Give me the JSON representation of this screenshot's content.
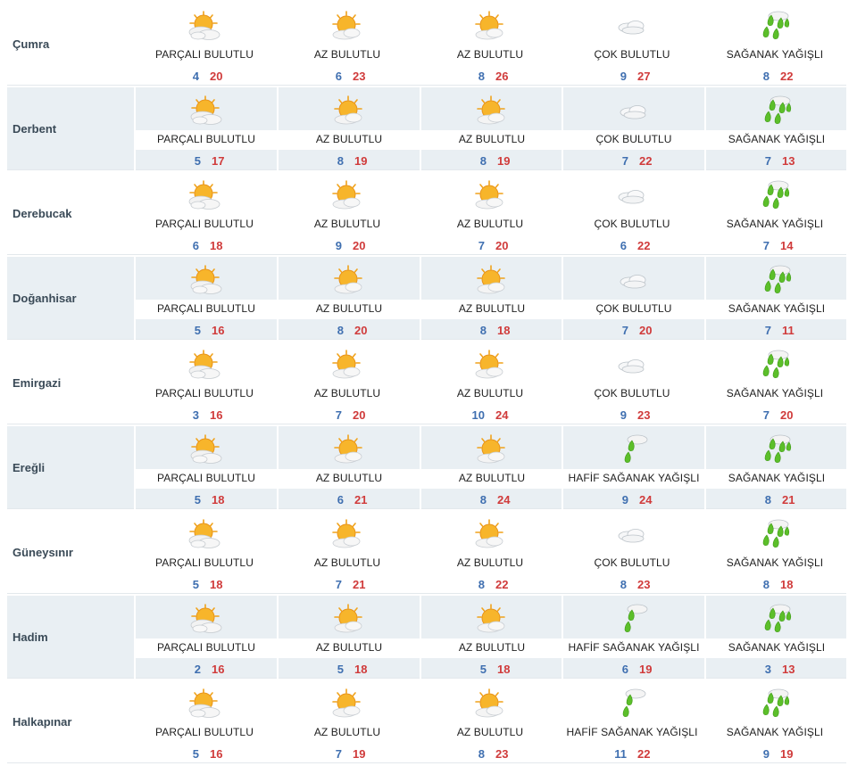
{
  "forecast": {
    "rows": [
      {
        "city": "Çumra",
        "days": [
          {
            "icon": "partly-cloudy-icon",
            "desc": "PARÇALI BULUTLU",
            "min": "4",
            "max": "20"
          },
          {
            "icon": "mostly-sunny-icon",
            "desc": "AZ BULUTLU",
            "min": "6",
            "max": "23"
          },
          {
            "icon": "mostly-sunny-icon",
            "desc": "AZ BULUTLU",
            "min": "8",
            "max": "26"
          },
          {
            "icon": "cloudy-icon",
            "desc": "ÇOK BULUTLU",
            "min": "9",
            "max": "27"
          },
          {
            "icon": "showers-icon",
            "desc": "SAĞANAK YAĞIŞLI",
            "min": "8",
            "max": "22"
          }
        ]
      },
      {
        "city": "Derbent",
        "days": [
          {
            "icon": "partly-cloudy-icon",
            "desc": "PARÇALI BULUTLU",
            "min": "5",
            "max": "17"
          },
          {
            "icon": "mostly-sunny-icon",
            "desc": "AZ BULUTLU",
            "min": "8",
            "max": "19"
          },
          {
            "icon": "mostly-sunny-icon",
            "desc": "AZ BULUTLU",
            "min": "8",
            "max": "19"
          },
          {
            "icon": "cloudy-icon",
            "desc": "ÇOK BULUTLU",
            "min": "7",
            "max": "22"
          },
          {
            "icon": "showers-icon",
            "desc": "SAĞANAK YAĞIŞLI",
            "min": "7",
            "max": "13"
          }
        ]
      },
      {
        "city": "Derebucak",
        "days": [
          {
            "icon": "partly-cloudy-icon",
            "desc": "PARÇALI BULUTLU",
            "min": "6",
            "max": "18"
          },
          {
            "icon": "mostly-sunny-icon",
            "desc": "AZ BULUTLU",
            "min": "9",
            "max": "20"
          },
          {
            "icon": "mostly-sunny-icon",
            "desc": "AZ BULUTLU",
            "min": "7",
            "max": "20"
          },
          {
            "icon": "cloudy-icon",
            "desc": "ÇOK BULUTLU",
            "min": "6",
            "max": "22"
          },
          {
            "icon": "showers-icon",
            "desc": "SAĞANAK YAĞIŞLI",
            "min": "7",
            "max": "14"
          }
        ]
      },
      {
        "city": "Doğanhisar",
        "days": [
          {
            "icon": "partly-cloudy-icon",
            "desc": "PARÇALI BULUTLU",
            "min": "5",
            "max": "16"
          },
          {
            "icon": "mostly-sunny-icon",
            "desc": "AZ BULUTLU",
            "min": "8",
            "max": "20"
          },
          {
            "icon": "mostly-sunny-icon",
            "desc": "AZ BULUTLU",
            "min": "8",
            "max": "18"
          },
          {
            "icon": "cloudy-icon",
            "desc": "ÇOK BULUTLU",
            "min": "7",
            "max": "20"
          },
          {
            "icon": "showers-icon",
            "desc": "SAĞANAK YAĞIŞLI",
            "min": "7",
            "max": "11"
          }
        ]
      },
      {
        "city": "Emirgazi",
        "days": [
          {
            "icon": "partly-cloudy-icon",
            "desc": "PARÇALI BULUTLU",
            "min": "3",
            "max": "16"
          },
          {
            "icon": "mostly-sunny-icon",
            "desc": "AZ BULUTLU",
            "min": "7",
            "max": "20"
          },
          {
            "icon": "mostly-sunny-icon",
            "desc": "AZ BULUTLU",
            "min": "10",
            "max": "24"
          },
          {
            "icon": "cloudy-icon",
            "desc": "ÇOK BULUTLU",
            "min": "9",
            "max": "23"
          },
          {
            "icon": "showers-icon",
            "desc": "SAĞANAK YAĞIŞLI",
            "min": "7",
            "max": "20"
          }
        ]
      },
      {
        "city": "Ereğli",
        "days": [
          {
            "icon": "partly-cloudy-icon",
            "desc": "PARÇALI BULUTLU",
            "min": "5",
            "max": "18"
          },
          {
            "icon": "mostly-sunny-icon",
            "desc": "AZ BULUTLU",
            "min": "6",
            "max": "21"
          },
          {
            "icon": "mostly-sunny-icon",
            "desc": "AZ BULUTLU",
            "min": "8",
            "max": "24"
          },
          {
            "icon": "light-showers-icon",
            "desc": "HAFİF SAĞANAK YAĞIŞLI",
            "min": "9",
            "max": "24"
          },
          {
            "icon": "showers-icon",
            "desc": "SAĞANAK YAĞIŞLI",
            "min": "8",
            "max": "21"
          }
        ]
      },
      {
        "city": "Güneysınır",
        "days": [
          {
            "icon": "partly-cloudy-icon",
            "desc": "PARÇALI BULUTLU",
            "min": "5",
            "max": "18"
          },
          {
            "icon": "mostly-sunny-icon",
            "desc": "AZ BULUTLU",
            "min": "7",
            "max": "21"
          },
          {
            "icon": "mostly-sunny-icon",
            "desc": "AZ BULUTLU",
            "min": "8",
            "max": "22"
          },
          {
            "icon": "cloudy-icon",
            "desc": "ÇOK BULUTLU",
            "min": "8",
            "max": "23"
          },
          {
            "icon": "showers-icon",
            "desc": "SAĞANAK YAĞIŞLI",
            "min": "8",
            "max": "18"
          }
        ]
      },
      {
        "city": "Hadim",
        "days": [
          {
            "icon": "partly-cloudy-icon",
            "desc": "PARÇALI BULUTLU",
            "min": "2",
            "max": "16"
          },
          {
            "icon": "mostly-sunny-icon",
            "desc": "AZ BULUTLU",
            "min": "5",
            "max": "18"
          },
          {
            "icon": "mostly-sunny-icon",
            "desc": "AZ BULUTLU",
            "min": "5",
            "max": "18"
          },
          {
            "icon": "light-showers-icon",
            "desc": "HAFİF SAĞANAK YAĞIŞLI",
            "min": "6",
            "max": "19"
          },
          {
            "icon": "showers-icon",
            "desc": "SAĞANAK YAĞIŞLI",
            "min": "3",
            "max": "13"
          }
        ]
      },
      {
        "city": "Halkapınar",
        "days": [
          {
            "icon": "partly-cloudy-icon",
            "desc": "PARÇALI BULUTLU",
            "min": "5",
            "max": "16"
          },
          {
            "icon": "mostly-sunny-icon",
            "desc": "AZ BULUTLU",
            "min": "7",
            "max": "19"
          },
          {
            "icon": "mostly-sunny-icon",
            "desc": "AZ BULUTLU",
            "min": "8",
            "max": "23"
          },
          {
            "icon": "light-showers-icon",
            "desc": "HAFİF SAĞANAK YAĞIŞLI",
            "min": "11",
            "max": "22"
          },
          {
            "icon": "showers-icon",
            "desc": "SAĞANAK YAĞIŞLI",
            "min": "9",
            "max": "19"
          }
        ]
      }
    ]
  },
  "colors": {
    "min_temp": "#3f6fb0",
    "max_temp": "#d03b3b",
    "row_shade": "#e9eff3",
    "city_text": "#3a4a57"
  }
}
